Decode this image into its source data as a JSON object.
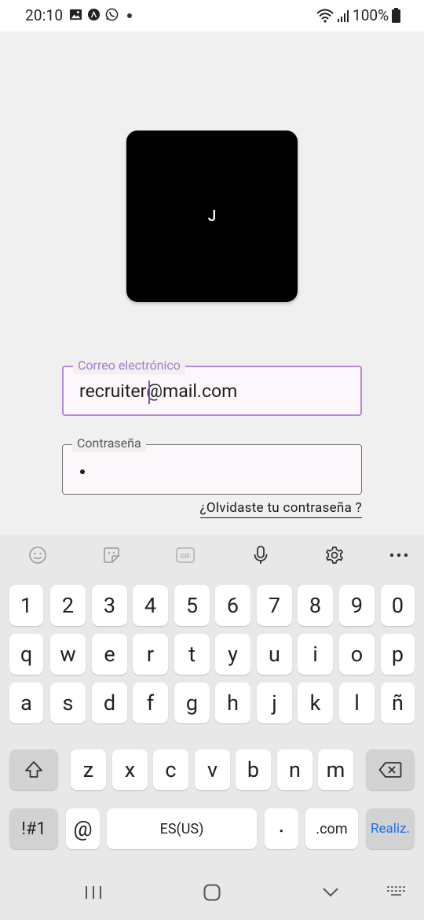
{
  "status_bar": {
    "time": "20:10",
    "battery": "100%",
    "left_icons": [
      "gallery-icon",
      "app-notification-icon",
      "whatsapp-icon"
    ],
    "right_icons": [
      "wifi-icon",
      "signal-icon",
      "battery-icon"
    ]
  },
  "logo": {
    "letter": "J"
  },
  "email_field": {
    "label": "Correo electrónico",
    "value": "recruiter@mail.com"
  },
  "password_field": {
    "label": "Contraseña",
    "masked_length": 1
  },
  "forgot_link": "¿Olvidaste tu contraseña ?",
  "keyboard": {
    "toolbar": [
      "emoji-icon",
      "sticker-icon",
      "gif-icon",
      "microphone-icon",
      "settings-icon",
      "more-icon"
    ],
    "gif_label": "GIF",
    "row_numbers": [
      "1",
      "2",
      "3",
      "4",
      "5",
      "6",
      "7",
      "8",
      "9",
      "0"
    ],
    "row_1": [
      "q",
      "w",
      "e",
      "r",
      "t",
      "y",
      "u",
      "i",
      "o",
      "p"
    ],
    "row_2": [
      "a",
      "s",
      "d",
      "f",
      "g",
      "h",
      "j",
      "k",
      "l",
      "ñ"
    ],
    "row_3": [
      "z",
      "x",
      "c",
      "v",
      "b",
      "n",
      "m"
    ],
    "bottom": {
      "symbols": "!#1",
      "at": "@",
      "space": "ES(US)",
      "period": ".",
      "dotcom": ".com",
      "action": "Realiz."
    }
  },
  "colors": {
    "accent": "#b787d6",
    "action_blue": "#1a73e8",
    "background": "#f0f0f0",
    "keyboard_bg": "#e8e8e8"
  }
}
